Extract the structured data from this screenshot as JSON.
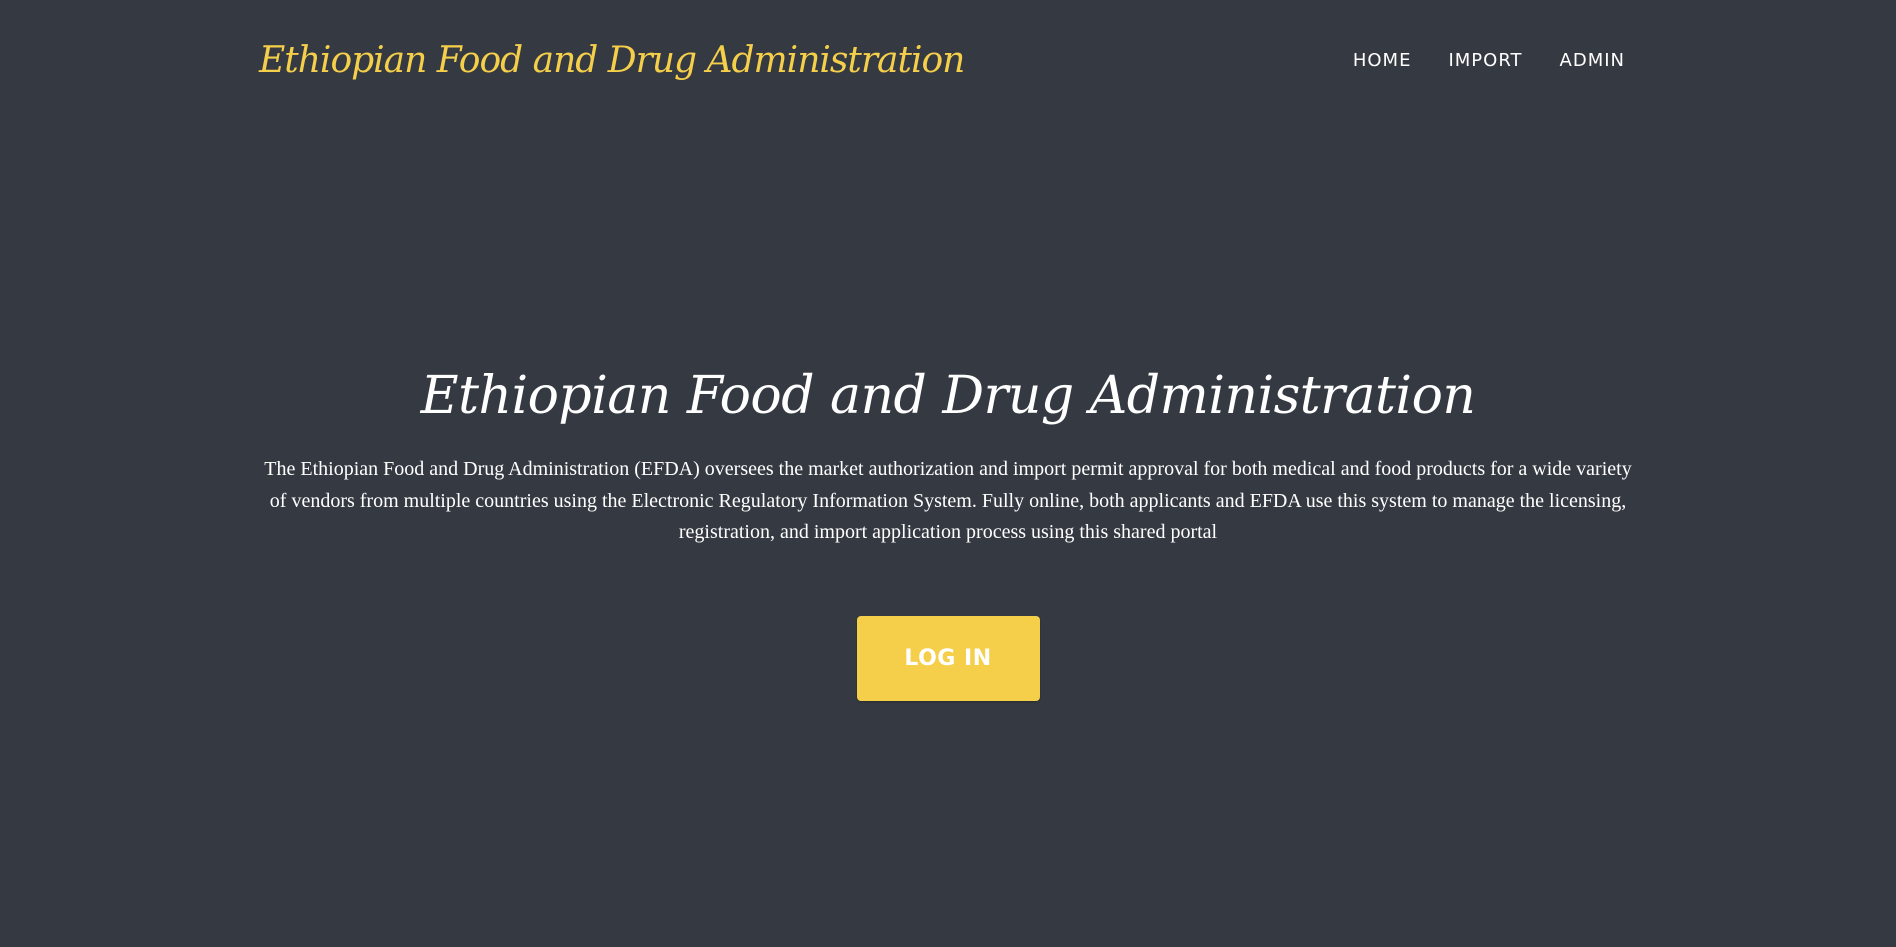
{
  "header": {
    "brand": "Ethiopian Food and Drug Administration",
    "nav": [
      {
        "label": "HOME"
      },
      {
        "label": "IMPORT"
      },
      {
        "label": "ADMIN"
      }
    ]
  },
  "hero": {
    "title": "Ethiopian Food and Drug Administration",
    "description": "The Ethiopian Food and Drug Administration (EFDA) oversees the market authorization and import permit approval for both medical and food products for a wide variety of vendors from multiple countries using the Electronic Regulatory Information System. Fully online, both applicants and EFDA use this system to manage the licensing, registration, and import application process using this shared portal",
    "login_label": "LOG IN"
  },
  "colors": {
    "background": "#353a42",
    "accent": "#f5cf4a",
    "text": "#ffffff"
  }
}
